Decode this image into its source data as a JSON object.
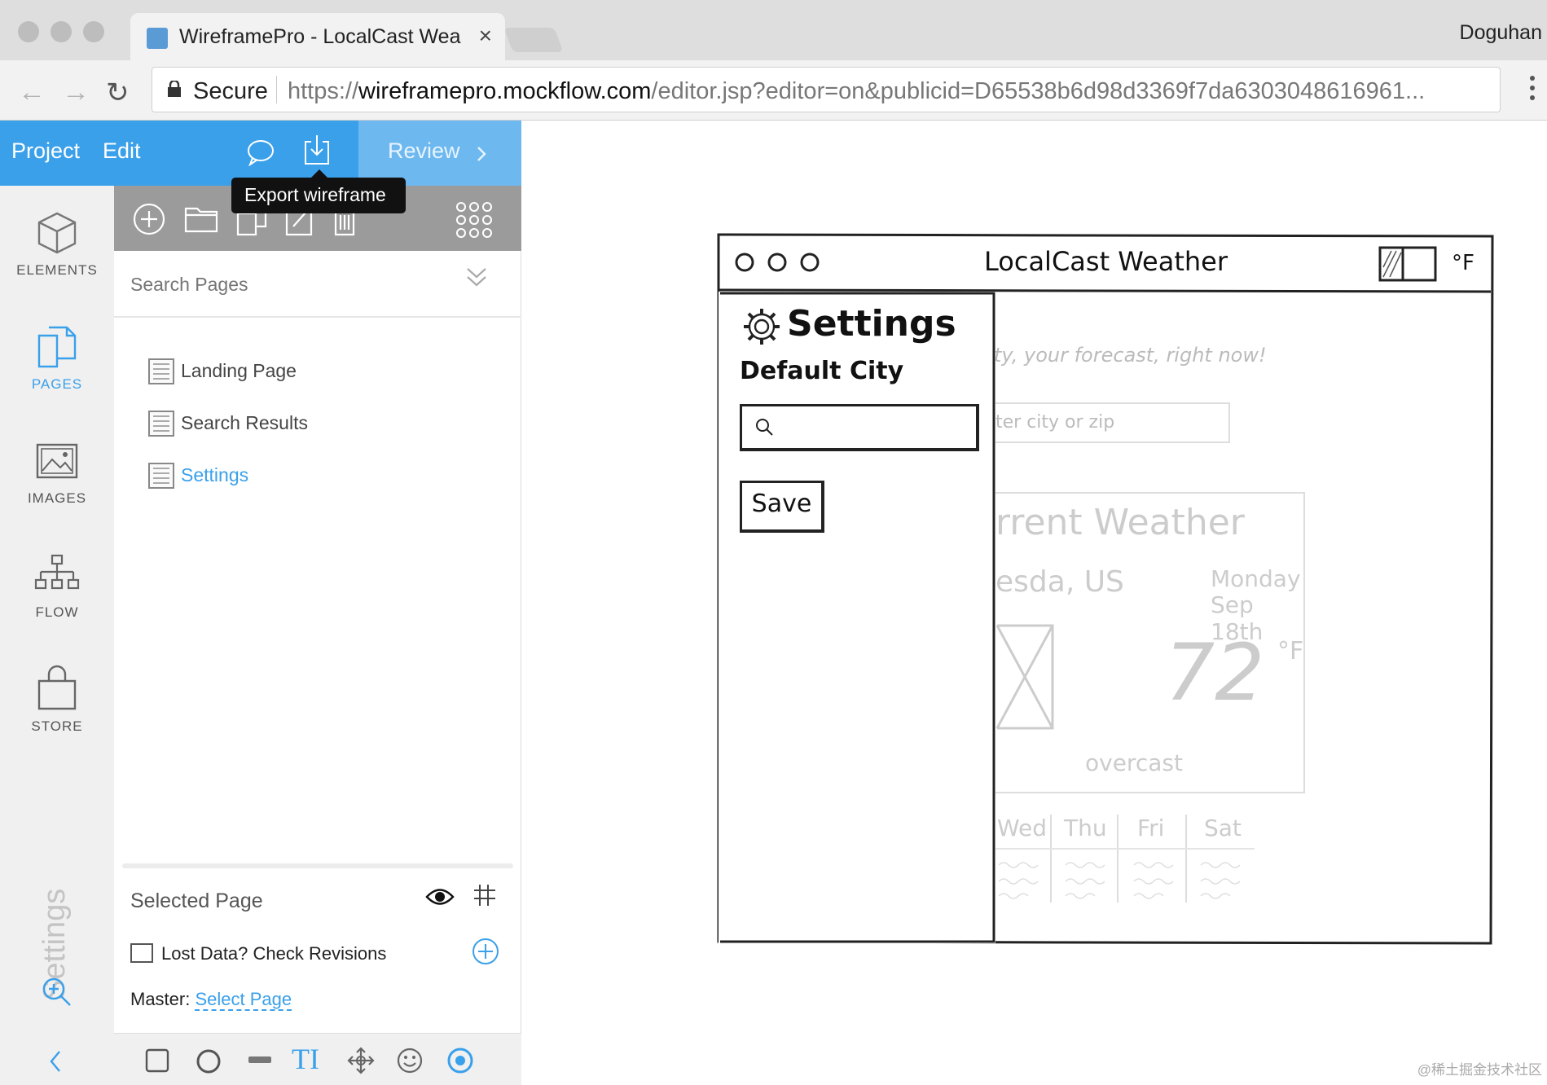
{
  "browser": {
    "tab_title": "WireframePro - LocalCast Wea",
    "user": "Doguhan",
    "secure_label": "Secure",
    "url_scheme": "https://",
    "url_domain": "wireframepro.mockflow.com",
    "url_path": "/editor.jsp?editor=on&publicid=D65538b6d98d3369f7da6303048616961..."
  },
  "topbar": {
    "project": "Project",
    "edit": "Edit",
    "review": "Review",
    "tooltip": "Export wireframe"
  },
  "sidebar": {
    "items": [
      {
        "label": "ELEMENTS",
        "icon": "cube-icon"
      },
      {
        "label": "PAGES",
        "icon": "pages-icon"
      },
      {
        "label": "IMAGES",
        "icon": "image-icon"
      },
      {
        "label": "FLOW",
        "icon": "flow-icon"
      },
      {
        "label": "STORE",
        "icon": "bag-icon"
      }
    ],
    "settings": "Settings"
  },
  "panel": {
    "search_placeholder": "Search Pages",
    "pages": [
      "Landing Page",
      "Search Results",
      "Settings"
    ],
    "active_page": "Settings",
    "selected_page": "Selected Page",
    "lost_data": "Lost Data? Check Revisions",
    "master_label": "Master:",
    "master_link": "Select Page"
  },
  "wireframe": {
    "app_title": "LocalCast Weather",
    "unit": "°F",
    "settings_title": "Settings",
    "default_city": "Default City",
    "save": "Save",
    "tagline": "ty, your forecast, right now!",
    "city_placeholder": "ter city or zip",
    "current_weather": "rrent Weather",
    "location": "esda, US",
    "day": "Monday",
    "date": "Sep 18th",
    "temp": "72",
    "temp_unit": "°F",
    "condition": "overcast",
    "forecast_days": [
      "Wed",
      "Thu",
      "Fri",
      "Sat"
    ]
  },
  "watermark": "@稀土掘金技术社区"
}
